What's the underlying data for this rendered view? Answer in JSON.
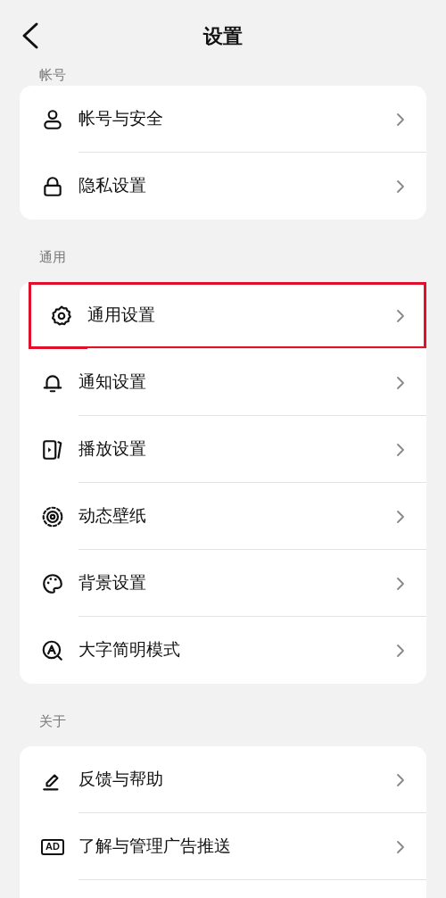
{
  "header": {
    "title": "设置"
  },
  "sections": [
    {
      "label": "帐号",
      "items": [
        {
          "label": "帐号与安全",
          "highlighted": false
        },
        {
          "label": "隐私设置",
          "highlighted": false
        }
      ]
    },
    {
      "label": "通用",
      "items": [
        {
          "label": "通用设置",
          "highlighted": true
        },
        {
          "label": "通知设置",
          "highlighted": false
        },
        {
          "label": "播放设置",
          "highlighted": false
        },
        {
          "label": "动态壁纸",
          "highlighted": false
        },
        {
          "label": "背景设置",
          "highlighted": false
        },
        {
          "label": "大字简明模式",
          "highlighted": false
        }
      ]
    },
    {
      "label": "关于",
      "items": [
        {
          "label": "反馈与帮助",
          "highlighted": false
        },
        {
          "icon_text": "AD",
          "label": "了解与管理广告推送",
          "highlighted": false
        }
      ]
    }
  ]
}
